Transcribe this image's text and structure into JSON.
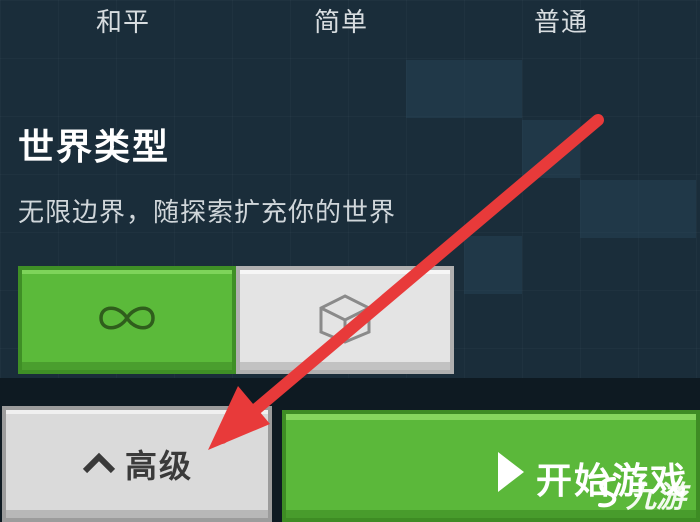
{
  "difficulty": {
    "options": [
      "和平",
      "简单",
      "普通"
    ]
  },
  "world_type": {
    "title": "世界类型",
    "description": "无限边界，随探索扩充你的世界",
    "options": [
      {
        "icon": "infinity-icon",
        "selected": true
      },
      {
        "icon": "cube-icon",
        "selected": false
      }
    ]
  },
  "buttons": {
    "advanced_label": "高级",
    "start_label": "开始游戏"
  },
  "watermark": {
    "text": "九游"
  },
  "colors": {
    "green": "#5bba3a",
    "gray": "#e4e4e4",
    "annotation": "#e83a3a",
    "background": "#1a2d3a"
  }
}
